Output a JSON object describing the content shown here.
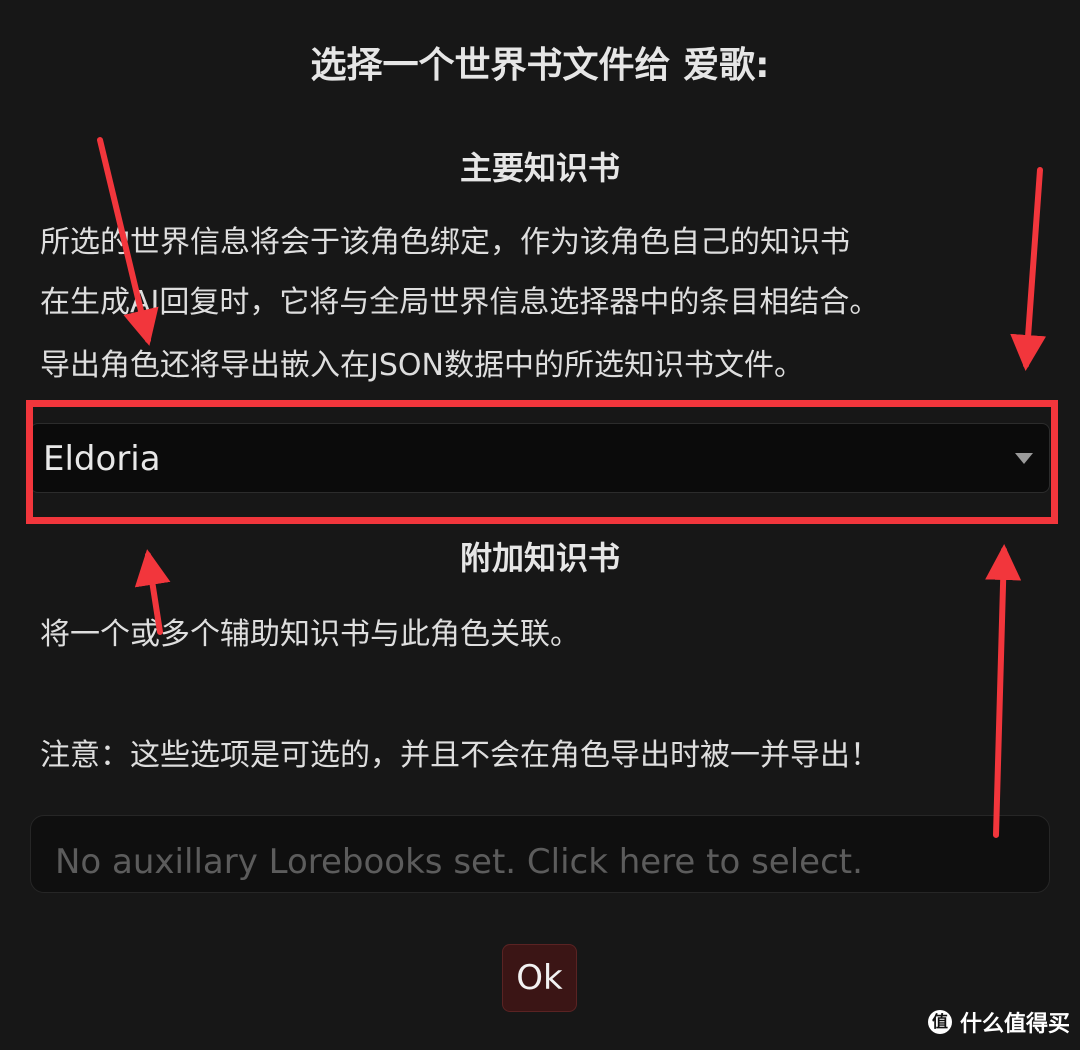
{
  "dialog": {
    "title": "选择一个世界书文件给 爱歌:",
    "primary": {
      "heading": "主要知识书",
      "lines": [
        "所选的世界信息将会于该角色绑定，作为该角色自己的知识书",
        "在生成AI回复时，它将与全局世界信息选择器中的条目相结合。",
        "导出角色还将导出嵌入在JSON数据中的所选知识书文件。"
      ],
      "select_value": "Eldoria"
    },
    "auxiliary": {
      "heading": "附加知识书",
      "description": "将一个或多个辅助知识书与此角色关联。",
      "note": "注意：这些选项是可选的，并且不会在角色导出时被一并导出！",
      "placeholder": "No auxillary Lorebooks set. Click here to select."
    },
    "ok_label": "Ok"
  },
  "annotation": {
    "color": "#f2363c"
  },
  "watermark": {
    "icon": "值",
    "text": "什么值得买"
  }
}
